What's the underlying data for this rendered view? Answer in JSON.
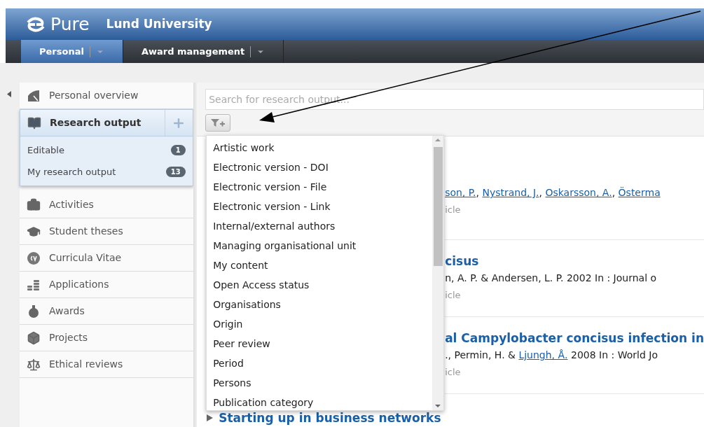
{
  "header": {
    "logo": "Pure",
    "organisation": "Lund University"
  },
  "nav_tabs": [
    {
      "label": "Personal",
      "selected": true
    },
    {
      "label": "Award management",
      "selected": false
    }
  ],
  "sidebar": {
    "items": [
      {
        "label": "Personal overview",
        "kind": "overview",
        "selected": false
      },
      {
        "label": "Research output",
        "kind": "book",
        "selected": true,
        "children": [
          {
            "label": "Editable",
            "count": "1"
          },
          {
            "label": "My research output",
            "count": "13"
          }
        ]
      },
      {
        "label": "Activities",
        "kind": "briefcase",
        "selected": false
      },
      {
        "label": "Student theses",
        "kind": "cap",
        "selected": false
      },
      {
        "label": "Curricula Vitae",
        "kind": "cv",
        "selected": false
      },
      {
        "label": "Applications",
        "kind": "coins",
        "selected": false
      },
      {
        "label": "Awards",
        "kind": "award",
        "selected": false
      },
      {
        "label": "Projects",
        "kind": "box",
        "selected": false
      },
      {
        "label": "Ethical reviews",
        "kind": "scale",
        "selected": false
      }
    ]
  },
  "search": {
    "placeholder": "Search for research output..."
  },
  "filter_menu": {
    "items": [
      "Artistic work",
      "Electronic version - DOI",
      "Electronic version - File",
      "Electronic version - Link",
      "Internal/external authors",
      "Managing organisational unit",
      "My content",
      "Open Access status",
      "Organisations",
      "Origin",
      "Peer review",
      "Period",
      "Persons",
      "Publication category"
    ]
  },
  "results": [
    {
      "authors": [
        {
          "text": "son, P.",
          "link": true
        },
        {
          "text": ", ",
          "link": false
        },
        {
          "text": "Nystrand, J.",
          "link": true
        },
        {
          "text": ", ",
          "link": false
        },
        {
          "text": "Oskarsson, A.",
          "link": true
        },
        {
          "text": ", ",
          "link": false
        },
        {
          "text": "Österma",
          "link": true
        }
      ],
      "type": "icle"
    },
    {
      "title": "cisus",
      "authors": [
        {
          "text": "n, A. P. & Andersen, L. P. 2002 In : Journal o",
          "link": false
        }
      ],
      "type": "icle"
    },
    {
      "title": "al Campylobacter concisus infection in",
      "authors": [
        {
          "text": "., Permin, H. & ",
          "link": false
        },
        {
          "text": "Ljungh, Å.",
          "link": true
        },
        {
          "text": " 2008 In : World Jo",
          "link": false
        }
      ],
      "type": "icle"
    },
    {
      "title": "Starting up in business networks",
      "collapsed": true
    }
  ]
}
